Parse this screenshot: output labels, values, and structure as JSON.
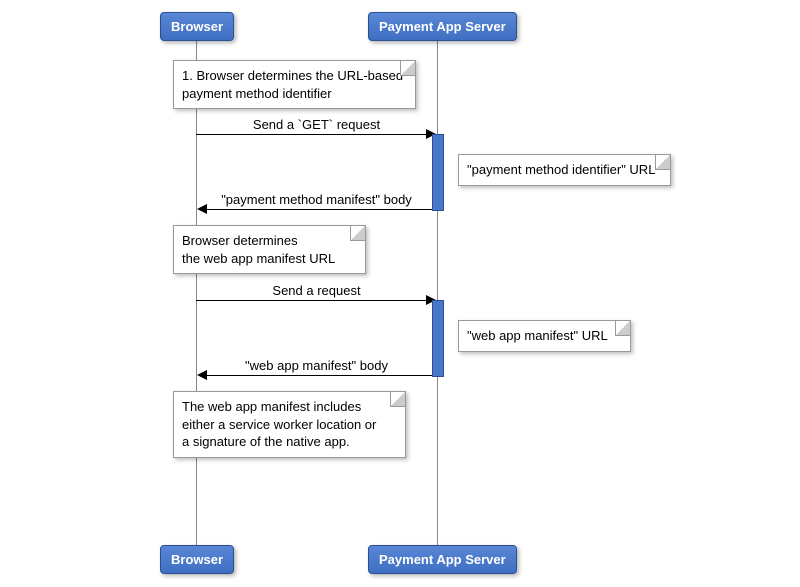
{
  "participants": {
    "browser": "Browser",
    "server": "Payment App Server"
  },
  "notes": {
    "n1_line1": "1. Browser determines the URL-based",
    "n1_line2": "payment method identifier",
    "n2": "\"payment method identifier\" URL",
    "n3_line1": "Browser determines",
    "n3_line2": "the web app manifest URL",
    "n4": "\"web app manifest\" URL",
    "n5_line1": "The web app manifest includes",
    "n5_line2": "either a service worker location or",
    "n5_line3": "a signature of the native app."
  },
  "messages": {
    "m1": "Send a `GET` request",
    "m2": "\"payment method manifest\" body",
    "m3": "Send a request",
    "m4": "\"web app manifest\" body"
  },
  "chart_data": {
    "type": "sequence-diagram",
    "participants": [
      "Browser",
      "Payment App Server"
    ],
    "steps": [
      {
        "type": "note",
        "at": "Browser",
        "text": "1. Browser determines the URL-based payment method identifier"
      },
      {
        "type": "message",
        "from": "Browser",
        "to": "Payment App Server",
        "text": "Send a `GET` request"
      },
      {
        "type": "note",
        "at": "Payment App Server",
        "text": "\"payment method identifier\" URL"
      },
      {
        "type": "message",
        "from": "Payment App Server",
        "to": "Browser",
        "text": "\"payment method manifest\" body"
      },
      {
        "type": "note",
        "at": "Browser",
        "text": "Browser determines the web app manifest URL"
      },
      {
        "type": "message",
        "from": "Browser",
        "to": "Payment App Server",
        "text": "Send a request"
      },
      {
        "type": "note",
        "at": "Payment App Server",
        "text": "\"web app manifest\" URL"
      },
      {
        "type": "message",
        "from": "Payment App Server",
        "to": "Browser",
        "text": "\"web app manifest\" body"
      },
      {
        "type": "note",
        "at": "Browser",
        "text": "The web app manifest includes either a service worker location or a signature of the native app."
      }
    ]
  }
}
